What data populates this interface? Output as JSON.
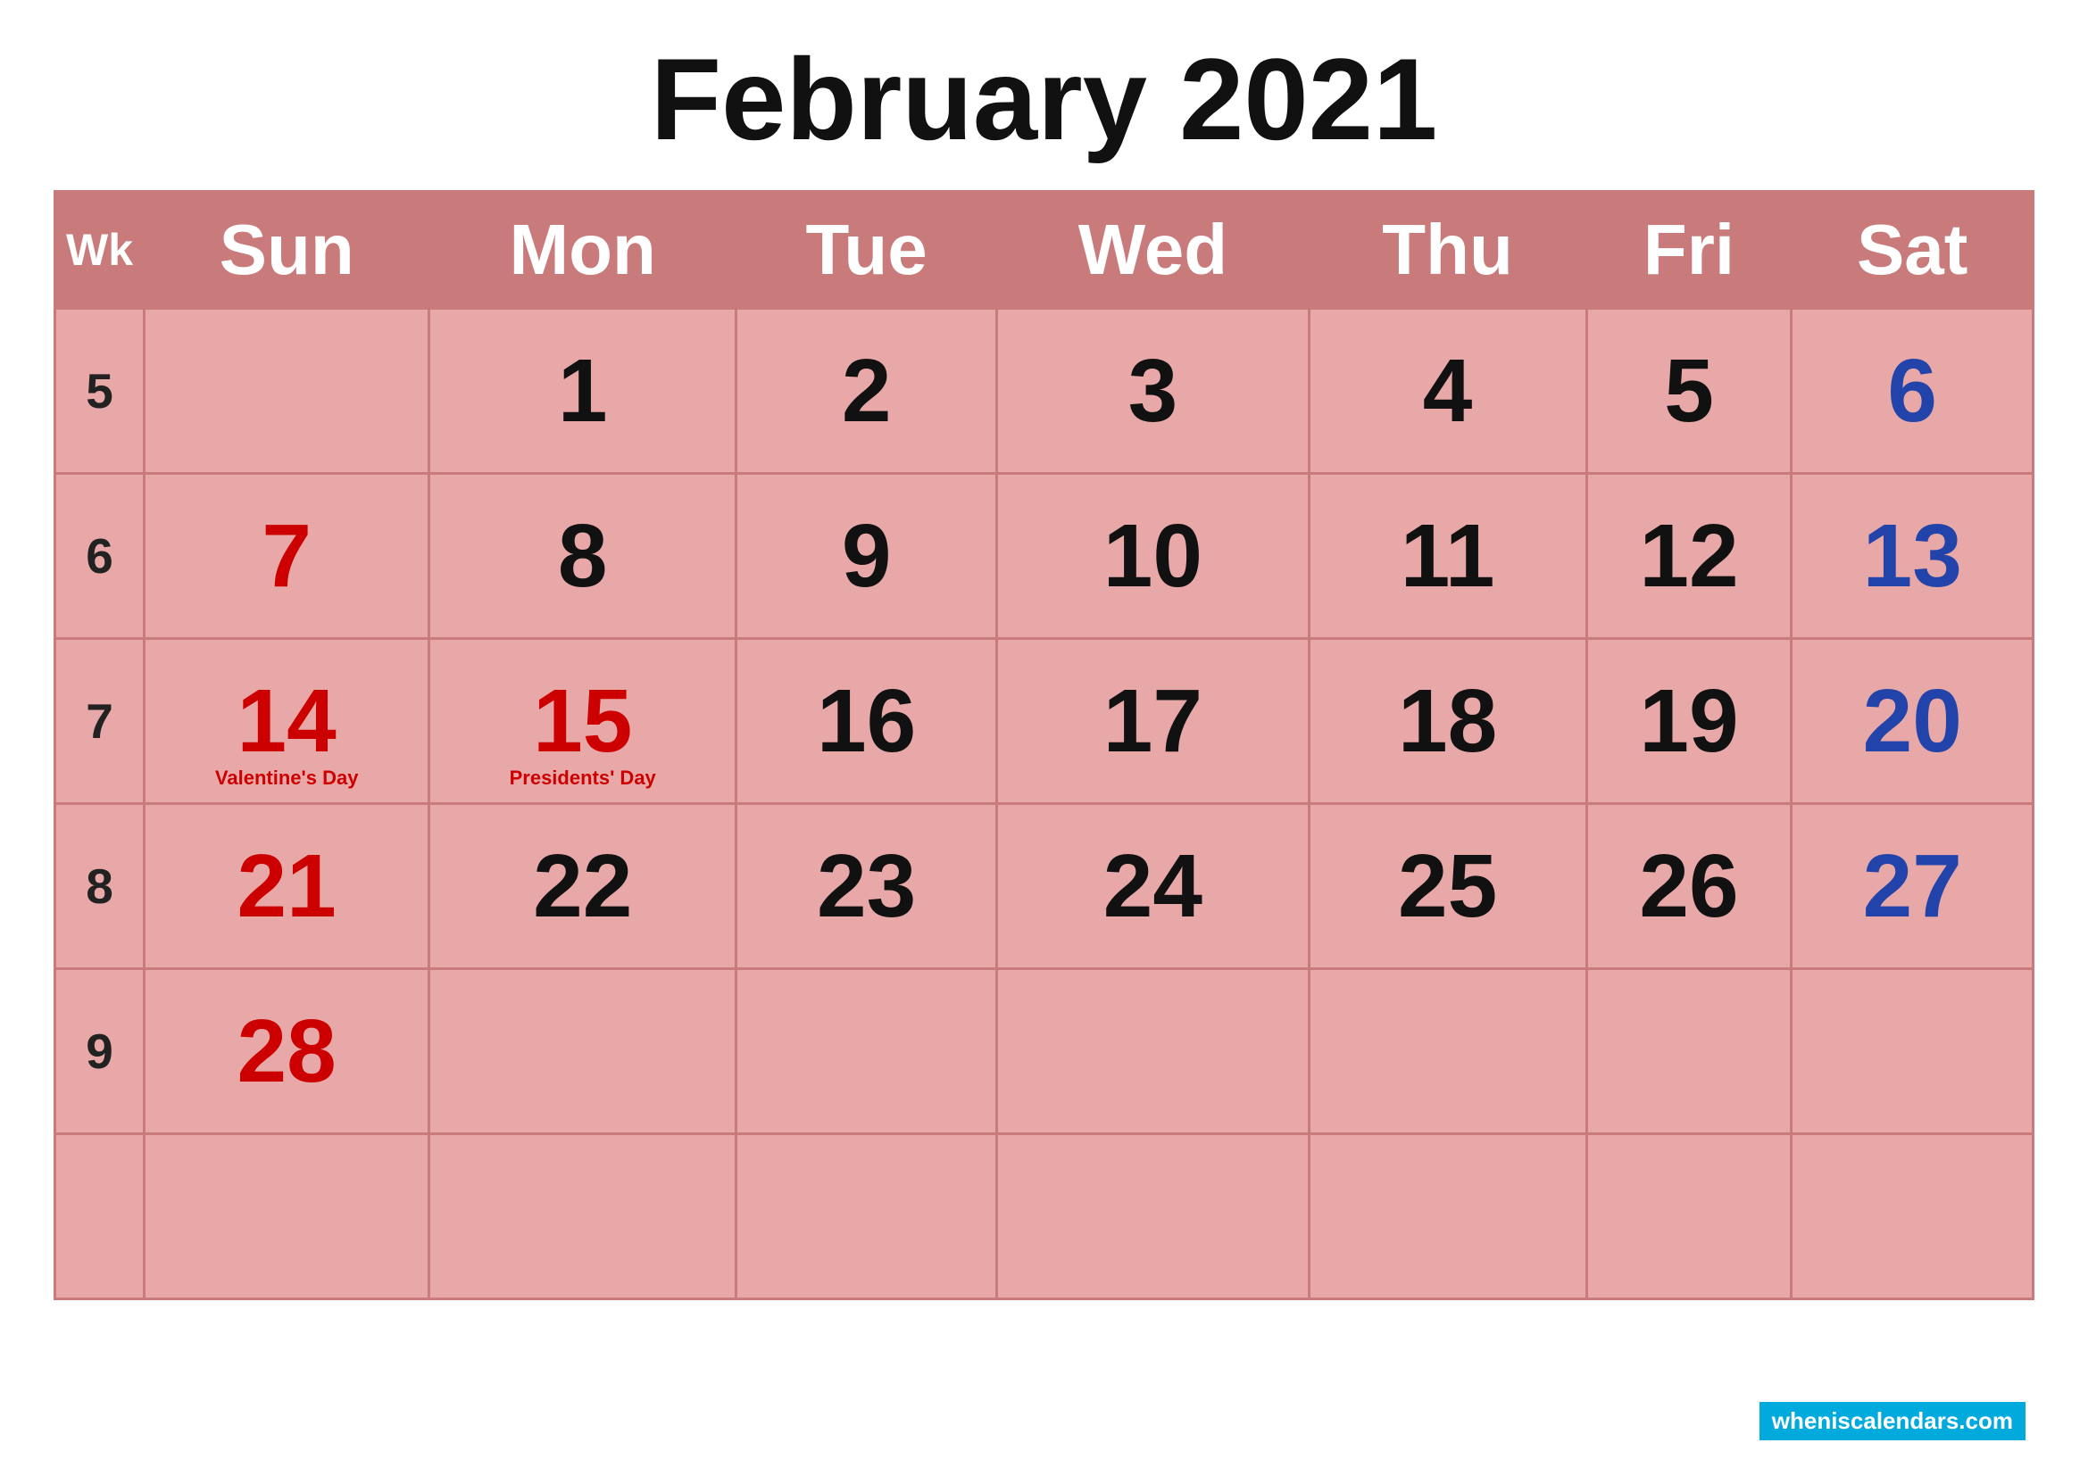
{
  "title": "February 2021",
  "header": {
    "columns": [
      "Wk",
      "Sun",
      "Mon",
      "Tue",
      "Wed",
      "Thu",
      "Fri",
      "Sat"
    ]
  },
  "weeks": [
    {
      "wk": "5",
      "days": [
        {
          "date": "",
          "type": "empty"
        },
        {
          "date": "1",
          "type": "normal"
        },
        {
          "date": "2",
          "type": "normal"
        },
        {
          "date": "3",
          "type": "normal"
        },
        {
          "date": "4",
          "type": "normal"
        },
        {
          "date": "5",
          "type": "normal"
        },
        {
          "date": "6",
          "type": "sat"
        }
      ]
    },
    {
      "wk": "6",
      "days": [
        {
          "date": "7",
          "type": "sun"
        },
        {
          "date": "8",
          "type": "normal"
        },
        {
          "date": "9",
          "type": "normal"
        },
        {
          "date": "10",
          "type": "normal"
        },
        {
          "date": "11",
          "type": "normal"
        },
        {
          "date": "12",
          "type": "normal"
        },
        {
          "date": "13",
          "type": "sat"
        }
      ]
    },
    {
      "wk": "7",
      "days": [
        {
          "date": "14",
          "type": "sun",
          "holiday": "Valentine's Day"
        },
        {
          "date": "15",
          "type": "holiday",
          "holiday": "Presidents' Day"
        },
        {
          "date": "16",
          "type": "normal"
        },
        {
          "date": "17",
          "type": "normal"
        },
        {
          "date": "18",
          "type": "normal"
        },
        {
          "date": "19",
          "type": "normal"
        },
        {
          "date": "20",
          "type": "sat"
        }
      ]
    },
    {
      "wk": "8",
      "days": [
        {
          "date": "21",
          "type": "sun"
        },
        {
          "date": "22",
          "type": "normal"
        },
        {
          "date": "23",
          "type": "normal"
        },
        {
          "date": "24",
          "type": "normal"
        },
        {
          "date": "25",
          "type": "normal"
        },
        {
          "date": "26",
          "type": "normal"
        },
        {
          "date": "27",
          "type": "sat"
        }
      ]
    },
    {
      "wk": "9",
      "days": [
        {
          "date": "28",
          "type": "sun"
        },
        {
          "date": "",
          "type": "empty"
        },
        {
          "date": "",
          "type": "empty"
        },
        {
          "date": "",
          "type": "empty"
        },
        {
          "date": "",
          "type": "empty"
        },
        {
          "date": "",
          "type": "empty"
        },
        {
          "date": "",
          "type": "empty"
        }
      ]
    }
  ],
  "footer": {
    "watermark": "wheniscalendars.com"
  }
}
